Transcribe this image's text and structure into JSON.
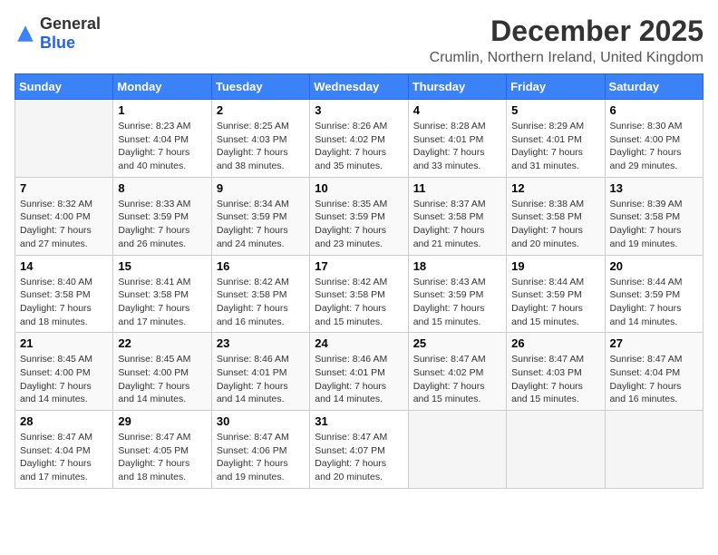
{
  "logo": {
    "general": "General",
    "blue": "Blue"
  },
  "title": "December 2025",
  "location": "Crumlin, Northern Ireland, United Kingdom",
  "weekdays": [
    "Sunday",
    "Monday",
    "Tuesday",
    "Wednesday",
    "Thursday",
    "Friday",
    "Saturday"
  ],
  "weeks": [
    [
      {
        "day": "",
        "info": ""
      },
      {
        "day": "1",
        "info": "Sunrise: 8:23 AM\nSunset: 4:04 PM\nDaylight: 7 hours\nand 40 minutes."
      },
      {
        "day": "2",
        "info": "Sunrise: 8:25 AM\nSunset: 4:03 PM\nDaylight: 7 hours\nand 38 minutes."
      },
      {
        "day": "3",
        "info": "Sunrise: 8:26 AM\nSunset: 4:02 PM\nDaylight: 7 hours\nand 35 minutes."
      },
      {
        "day": "4",
        "info": "Sunrise: 8:28 AM\nSunset: 4:01 PM\nDaylight: 7 hours\nand 33 minutes."
      },
      {
        "day": "5",
        "info": "Sunrise: 8:29 AM\nSunset: 4:01 PM\nDaylight: 7 hours\nand 31 minutes."
      },
      {
        "day": "6",
        "info": "Sunrise: 8:30 AM\nSunset: 4:00 PM\nDaylight: 7 hours\nand 29 minutes."
      }
    ],
    [
      {
        "day": "7",
        "info": "Sunrise: 8:32 AM\nSunset: 4:00 PM\nDaylight: 7 hours\nand 27 minutes."
      },
      {
        "day": "8",
        "info": "Sunrise: 8:33 AM\nSunset: 3:59 PM\nDaylight: 7 hours\nand 26 minutes."
      },
      {
        "day": "9",
        "info": "Sunrise: 8:34 AM\nSunset: 3:59 PM\nDaylight: 7 hours\nand 24 minutes."
      },
      {
        "day": "10",
        "info": "Sunrise: 8:35 AM\nSunset: 3:59 PM\nDaylight: 7 hours\nand 23 minutes."
      },
      {
        "day": "11",
        "info": "Sunrise: 8:37 AM\nSunset: 3:58 PM\nDaylight: 7 hours\nand 21 minutes."
      },
      {
        "day": "12",
        "info": "Sunrise: 8:38 AM\nSunset: 3:58 PM\nDaylight: 7 hours\nand 20 minutes."
      },
      {
        "day": "13",
        "info": "Sunrise: 8:39 AM\nSunset: 3:58 PM\nDaylight: 7 hours\nand 19 minutes."
      }
    ],
    [
      {
        "day": "14",
        "info": "Sunrise: 8:40 AM\nSunset: 3:58 PM\nDaylight: 7 hours\nand 18 minutes."
      },
      {
        "day": "15",
        "info": "Sunrise: 8:41 AM\nSunset: 3:58 PM\nDaylight: 7 hours\nand 17 minutes."
      },
      {
        "day": "16",
        "info": "Sunrise: 8:42 AM\nSunset: 3:58 PM\nDaylight: 7 hours\nand 16 minutes."
      },
      {
        "day": "17",
        "info": "Sunrise: 8:42 AM\nSunset: 3:58 PM\nDaylight: 7 hours\nand 15 minutes."
      },
      {
        "day": "18",
        "info": "Sunrise: 8:43 AM\nSunset: 3:59 PM\nDaylight: 7 hours\nand 15 minutes."
      },
      {
        "day": "19",
        "info": "Sunrise: 8:44 AM\nSunset: 3:59 PM\nDaylight: 7 hours\nand 15 minutes."
      },
      {
        "day": "20",
        "info": "Sunrise: 8:44 AM\nSunset: 3:59 PM\nDaylight: 7 hours\nand 14 minutes."
      }
    ],
    [
      {
        "day": "21",
        "info": "Sunrise: 8:45 AM\nSunset: 4:00 PM\nDaylight: 7 hours\nand 14 minutes."
      },
      {
        "day": "22",
        "info": "Sunrise: 8:45 AM\nSunset: 4:00 PM\nDaylight: 7 hours\nand 14 minutes."
      },
      {
        "day": "23",
        "info": "Sunrise: 8:46 AM\nSunset: 4:01 PM\nDaylight: 7 hours\nand 14 minutes."
      },
      {
        "day": "24",
        "info": "Sunrise: 8:46 AM\nSunset: 4:01 PM\nDaylight: 7 hours\nand 14 minutes."
      },
      {
        "day": "25",
        "info": "Sunrise: 8:47 AM\nSunset: 4:02 PM\nDaylight: 7 hours\nand 15 minutes."
      },
      {
        "day": "26",
        "info": "Sunrise: 8:47 AM\nSunset: 4:03 PM\nDaylight: 7 hours\nand 15 minutes."
      },
      {
        "day": "27",
        "info": "Sunrise: 8:47 AM\nSunset: 4:04 PM\nDaylight: 7 hours\nand 16 minutes."
      }
    ],
    [
      {
        "day": "28",
        "info": "Sunrise: 8:47 AM\nSunset: 4:04 PM\nDaylight: 7 hours\nand 17 minutes."
      },
      {
        "day": "29",
        "info": "Sunrise: 8:47 AM\nSunset: 4:05 PM\nDaylight: 7 hours\nand 18 minutes."
      },
      {
        "day": "30",
        "info": "Sunrise: 8:47 AM\nSunset: 4:06 PM\nDaylight: 7 hours\nand 19 minutes."
      },
      {
        "day": "31",
        "info": "Sunrise: 8:47 AM\nSunset: 4:07 PM\nDaylight: 7 hours\nand 20 minutes."
      },
      {
        "day": "",
        "info": ""
      },
      {
        "day": "",
        "info": ""
      },
      {
        "day": "",
        "info": ""
      }
    ]
  ]
}
